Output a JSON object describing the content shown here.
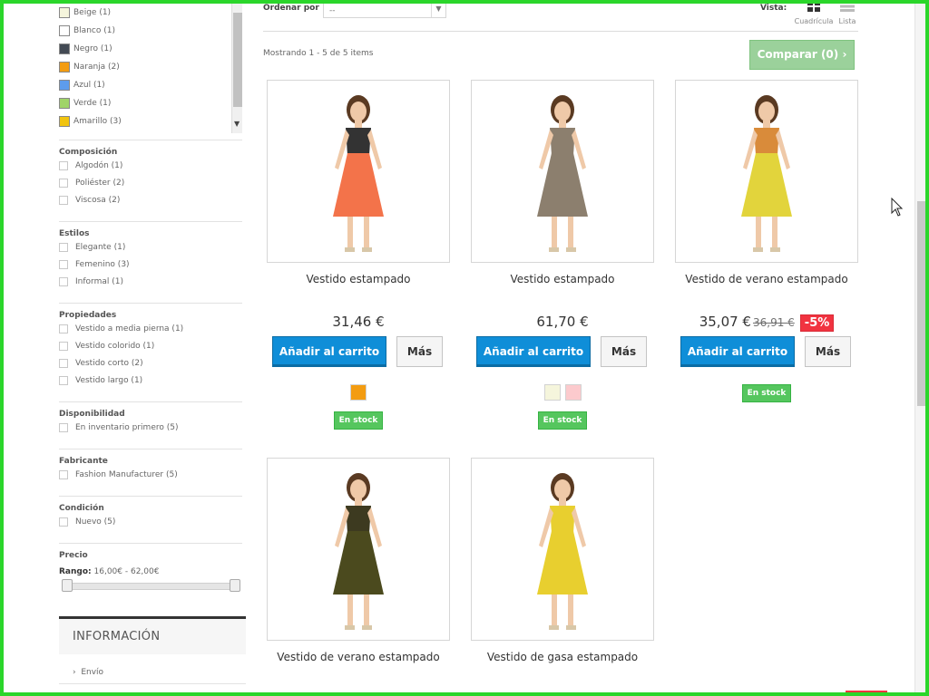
{
  "sidebar": {
    "colors": [
      {
        "label": "Beige (1)",
        "color": "#f5f5dc"
      },
      {
        "label": "Blanco (1)",
        "color": "#ffffff"
      },
      {
        "label": "Negro (1)",
        "color": "#434a54"
      },
      {
        "label": "Naranja (2)",
        "color": "#f39c11"
      },
      {
        "label": "Azul (1)",
        "color": "#5d9cec"
      },
      {
        "label": "Verde (1)",
        "color": "#a0d468"
      },
      {
        "label": "Amarillo (3)",
        "color": "#f1c40f"
      }
    ],
    "groups": [
      {
        "title": "Composición",
        "items": [
          "Algodón (1)",
          "Poliéster (2)",
          "Viscosa (2)"
        ]
      },
      {
        "title": "Estilos",
        "items": [
          "Elegante (1)",
          "Femenino (3)",
          "Informal (1)"
        ]
      },
      {
        "title": "Propiedades",
        "items": [
          "Vestido a media pierna (1)",
          "Vestido colorido (1)",
          "Vestido corto (2)",
          "Vestido largo (1)"
        ]
      },
      {
        "title": "Disponibilidad",
        "items": [
          "En inventario primero (5)"
        ]
      },
      {
        "title": "Fabricante",
        "items": [
          "Fashion Manufacturer (5)"
        ]
      },
      {
        "title": "Condición",
        "items": [
          "Nuevo (5)"
        ]
      }
    ],
    "price": {
      "title": "Precio",
      "range_label": "Rango:",
      "range_value": "16,00€ - 62,00€"
    },
    "info": {
      "title": "INFORMACIÓN",
      "first_link": "Envío"
    }
  },
  "toolbar": {
    "sort_label": "Ordenar por",
    "sort_value": "--",
    "view_label": "Vista:",
    "view_grid": "Cuadrícula",
    "view_list": "Lista",
    "showing": "Mostrando 1 - 5 de 5 items",
    "compare": "Comparar (0)"
  },
  "products": [
    {
      "name": "Vestido estampado",
      "price": "31,46 €",
      "old_price": "",
      "discount": "",
      "colors": [
        "#f39c11"
      ],
      "stock": "En stock",
      "add_label": "Añadir al carrito",
      "more_label": "Más",
      "dress": "#f3734a",
      "top": "#333333"
    },
    {
      "name": "Vestido estampado",
      "price": "61,70 €",
      "old_price": "",
      "discount": "",
      "colors": [
        "#f5f5dc",
        "#fccacd"
      ],
      "stock": "En stock",
      "add_label": "Añadir al carrito",
      "more_label": "Más",
      "dress": "#8c7f6e",
      "top": "#8c7f6e"
    },
    {
      "name": "Vestido de verano estampado",
      "price": "35,07 €",
      "old_price": "36,91 €",
      "discount": "-5%",
      "colors": [],
      "stock": "En stock",
      "add_label": "Añadir al carrito",
      "more_label": "Más",
      "dress": "#e2d43c",
      "top": "#d98b3a"
    },
    {
      "name": "Vestido de verano estampado",
      "price": "",
      "old_price": "",
      "discount": "",
      "colors": [],
      "stock": "",
      "add_label": "",
      "more_label": "",
      "dress": "#4b4a1e",
      "top": "#3d3a20"
    },
    {
      "name": "Vestido de gasa estampado",
      "price": "",
      "old_price": "",
      "discount": "",
      "colors": [],
      "stock": "",
      "add_label": "",
      "more_label": "",
      "dress": "#e8cf2f",
      "top": "#e8cf2f"
    }
  ]
}
